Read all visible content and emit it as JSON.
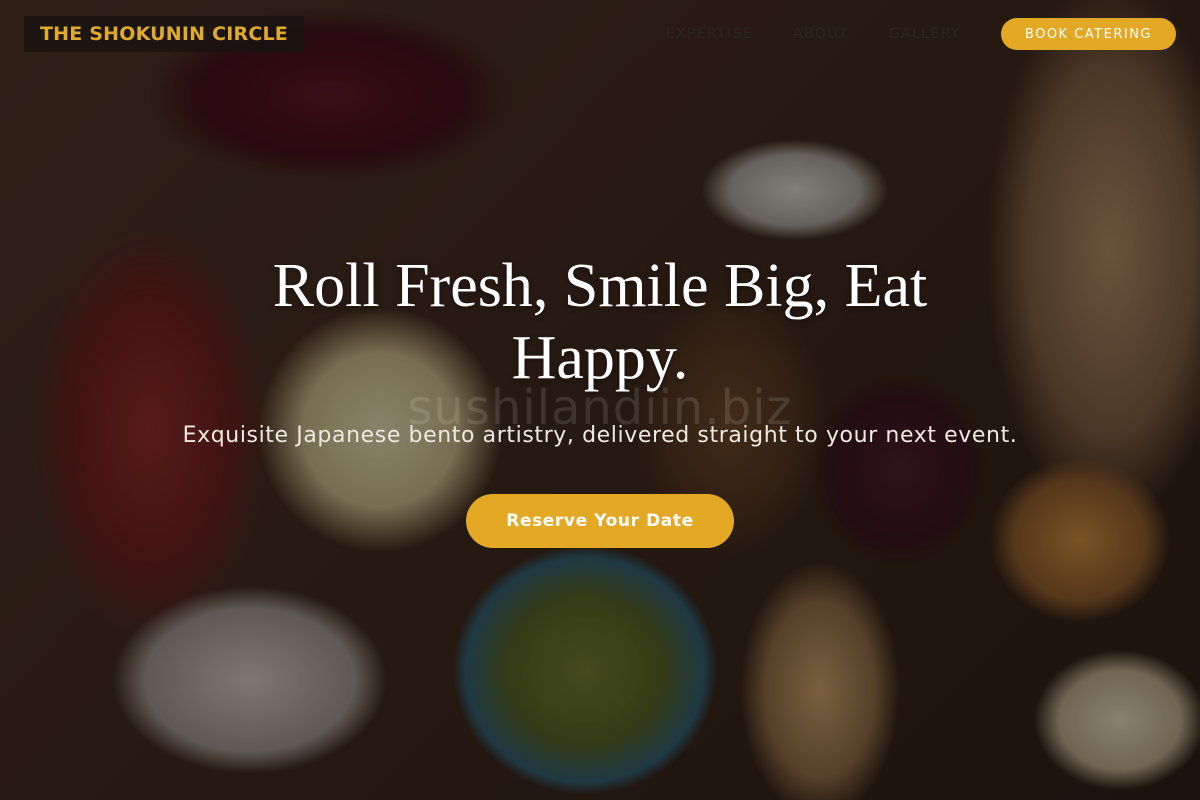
{
  "brand": {
    "name": "THE SHOKUNIN CIRCLE"
  },
  "nav": {
    "links": [
      "EXPERTISE",
      "ABOUT",
      "GALLERY"
    ],
    "cta_label": "BOOK CATERING"
  },
  "hero": {
    "headline": "Roll Fresh, Smile Big, Eat Happy.",
    "watermark": "sushilandiin.biz",
    "subtitle": "Exquisite Japanese bento artistry, delivered straight to your next event.",
    "cta_label": "Reserve Your Date"
  },
  "colors": {
    "accent": "#e3a924",
    "logo_text": "#e0aa2a",
    "logo_bg": "#181411"
  }
}
